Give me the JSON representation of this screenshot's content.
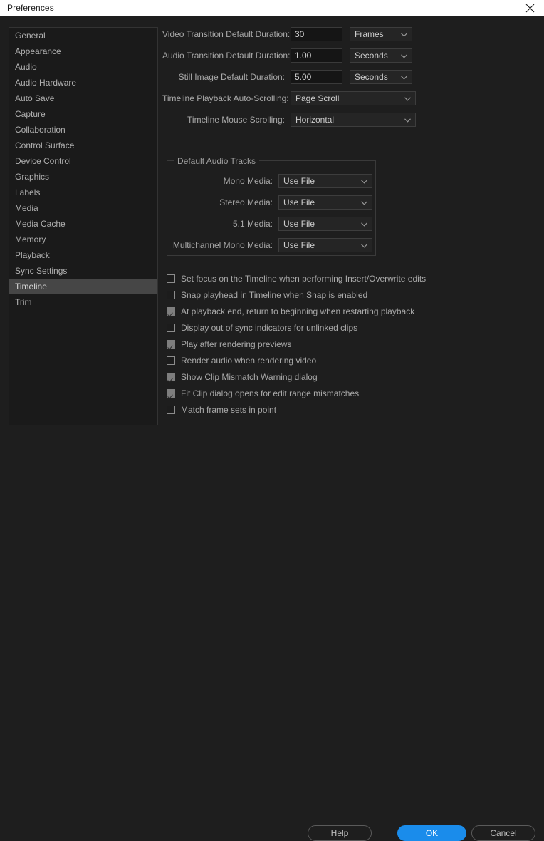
{
  "window": {
    "title": "Preferences",
    "close_icon": "close-icon"
  },
  "sidebar": {
    "items": [
      {
        "label": "General",
        "selected": false
      },
      {
        "label": "Appearance",
        "selected": false
      },
      {
        "label": "Audio",
        "selected": false
      },
      {
        "label": "Audio Hardware",
        "selected": false
      },
      {
        "label": "Auto Save",
        "selected": false
      },
      {
        "label": "Capture",
        "selected": false
      },
      {
        "label": "Collaboration",
        "selected": false
      },
      {
        "label": "Control Surface",
        "selected": false
      },
      {
        "label": "Device Control",
        "selected": false
      },
      {
        "label": "Graphics",
        "selected": false
      },
      {
        "label": "Labels",
        "selected": false
      },
      {
        "label": "Media",
        "selected": false
      },
      {
        "label": "Media Cache",
        "selected": false
      },
      {
        "label": "Memory",
        "selected": false
      },
      {
        "label": "Playback",
        "selected": false
      },
      {
        "label": "Sync Settings",
        "selected": false
      },
      {
        "label": "Timeline",
        "selected": true
      },
      {
        "label": "Trim",
        "selected": false
      }
    ]
  },
  "main": {
    "duration_rows": [
      {
        "label": "Video Transition Default Duration:",
        "value": "30",
        "unit": "Frames"
      },
      {
        "label": "Audio Transition Default Duration:",
        "value": "1.00",
        "unit": "Seconds"
      },
      {
        "label": "Still Image Default Duration:",
        "value": "5.00",
        "unit": "Seconds"
      }
    ],
    "scroll_rows": [
      {
        "label": "Timeline Playback Auto-Scrolling:",
        "value": "Page Scroll"
      },
      {
        "label": "Timeline Mouse Scrolling:",
        "value": "Horizontal"
      }
    ],
    "audio_group": {
      "legend": "Default Audio Tracks",
      "rows": [
        {
          "label": "Mono Media:",
          "value": "Use File"
        },
        {
          "label": "Stereo Media:",
          "value": "Use File"
        },
        {
          "label": "5.1 Media:",
          "value": "Use File"
        },
        {
          "label": "Multichannel Mono Media:",
          "value": "Use File"
        }
      ]
    },
    "checkboxes": [
      {
        "label": "Set focus on the Timeline when performing Insert/Overwrite edits",
        "checked": false
      },
      {
        "label": "Snap playhead in Timeline when Snap is enabled",
        "checked": false
      },
      {
        "label": "At playback end, return to beginning when restarting playback",
        "checked": true
      },
      {
        "label": "Display out of sync indicators for unlinked clips",
        "checked": false
      },
      {
        "label": "Play after rendering previews",
        "checked": true
      },
      {
        "label": "Render audio when rendering video",
        "checked": false
      },
      {
        "label": "Show Clip Mismatch Warning dialog",
        "checked": true
      },
      {
        "label": "Fit Clip dialog opens for edit range mismatches",
        "checked": true
      },
      {
        "label": "Match frame sets in point",
        "checked": false
      }
    ]
  },
  "footer": {
    "help_label": "Help",
    "ok_label": "OK",
    "cancel_label": "Cancel"
  },
  "colors": {
    "accent_blue": "#1a8ceb",
    "window_bg": "#1e1e1e",
    "sidebar_bg": "#1a1a1a",
    "selection": "#464646",
    "titlebar_bg": "#ffffff"
  }
}
